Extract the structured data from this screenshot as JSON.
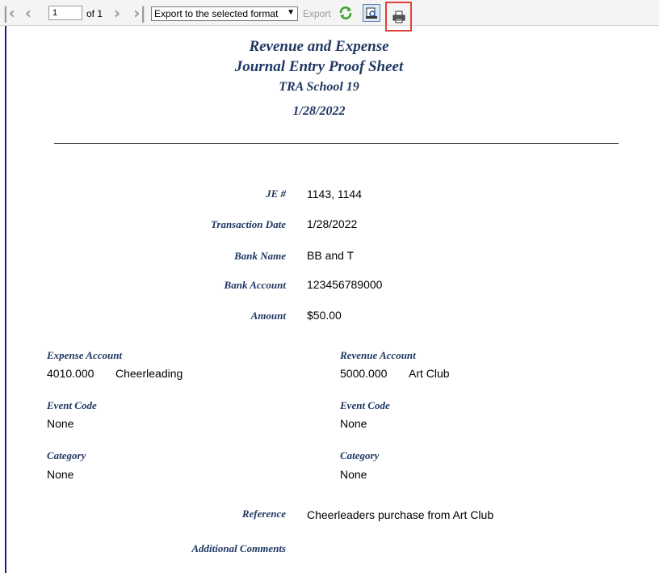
{
  "toolbar": {
    "page_value": "1",
    "of_label": "of 1",
    "export_format": "Export to the selected format",
    "export_label": "Export"
  },
  "report": {
    "title1": "Revenue and Expense",
    "title2": "Journal Entry Proof Sheet",
    "school": "TRA School 19",
    "date": "1/28/2022"
  },
  "fields": {
    "je_label": "JE #",
    "je_value": "1143, 1144",
    "trans_date_label": "Transaction Date",
    "trans_date_value": "1/28/2022",
    "bank_name_label": "Bank Name",
    "bank_name_value": "BB and T",
    "bank_account_label": "Bank Account",
    "bank_account_value": "123456789000",
    "amount_label": "Amount",
    "amount_value": "$50.00"
  },
  "expense": {
    "account_label": "Expense Account",
    "account_number": "4010.000",
    "account_name": "Cheerleading",
    "event_code_label": "Event Code",
    "event_code_value": "None",
    "category_label": "Category",
    "category_value": "None"
  },
  "revenue": {
    "account_label": "Revenue Account",
    "account_number": "5000.000",
    "account_name": "Art Club",
    "event_code_label": "Event Code",
    "event_code_value": "None",
    "category_label": "Category",
    "category_value": "None"
  },
  "footer": {
    "reference_label": "Reference",
    "reference_value": "Cheerleaders purchase from Art Club",
    "comments_label": "Additional Comments"
  }
}
